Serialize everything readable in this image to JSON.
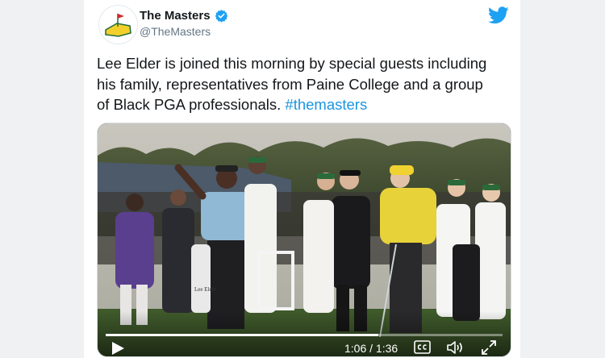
{
  "tweet": {
    "display_name": "The Masters",
    "handle": "@TheMasters",
    "text": "Lee Elder is joined this morning by special guests including his family, representatives from Paine College and a group of Black PGA professionals.",
    "hashtag": "#themasters",
    "verified": true
  },
  "video": {
    "current_time": "1:06",
    "separator": "/",
    "duration": "1:36",
    "progress_fraction": 0.6875,
    "bag_text": "Lee Elder"
  },
  "colors": {
    "brand_blue": "#1da1f2",
    "link": "#1b95e0",
    "text": "#14171a",
    "muted": "#657786",
    "masters_yellow": "#f3cf2c",
    "masters_green": "#1e6b3a"
  },
  "icons": {
    "verified": "verified-badge-icon",
    "twitter": "twitter-bird-icon",
    "play": "play-icon",
    "captions": "cc-icon",
    "volume": "volume-icon",
    "fullscreen": "fullscreen-icon"
  }
}
